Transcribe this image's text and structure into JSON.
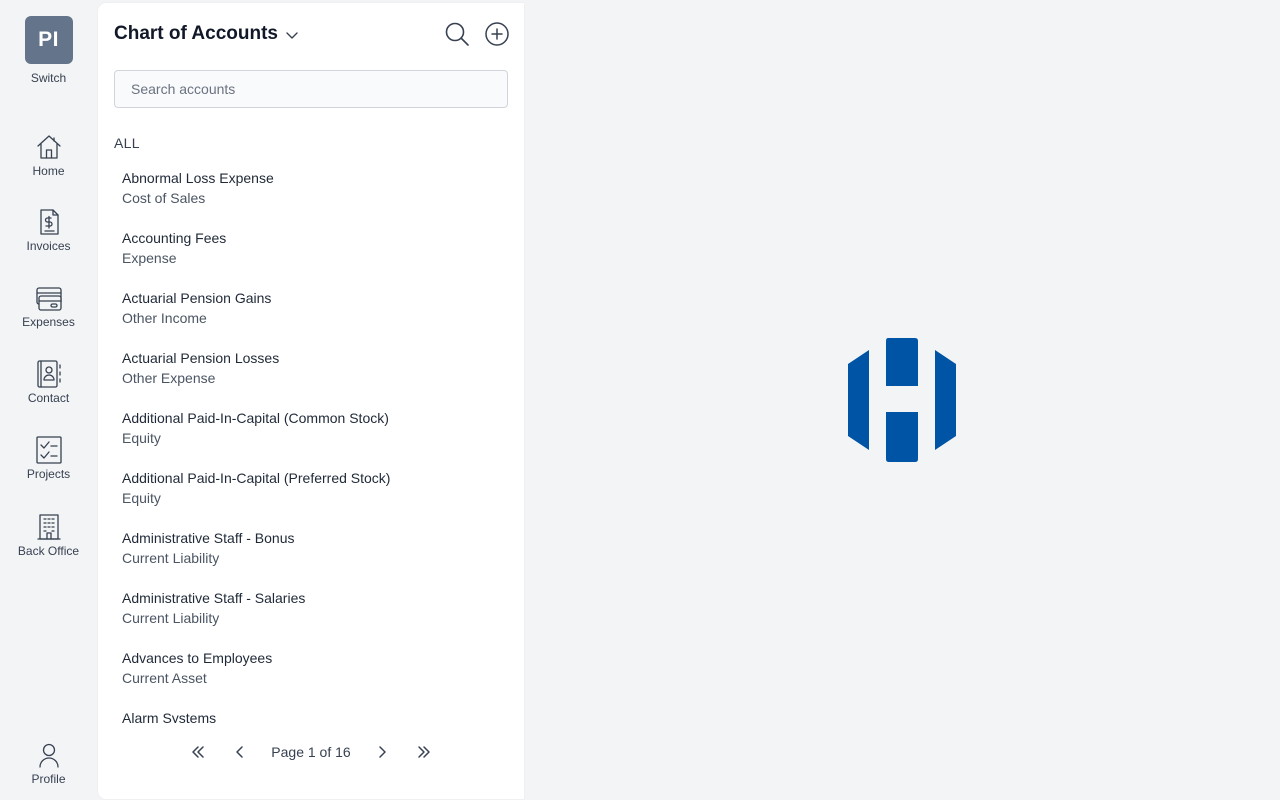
{
  "switch": {
    "badge": "PI",
    "label": "Switch"
  },
  "nav": {
    "home": "Home",
    "invoices": "Invoices",
    "expenses": "Expenses",
    "contact": "Contact",
    "projects": "Projects",
    "back_office": "Back Office",
    "profile": "Profile"
  },
  "panel": {
    "title": "Chart of Accounts",
    "search_placeholder": "Search accounts",
    "section_label": "ALL"
  },
  "accounts": [
    {
      "name": "Abnormal Loss Expense",
      "type": "Cost of Sales"
    },
    {
      "name": "Accounting Fees",
      "type": "Expense"
    },
    {
      "name": "Actuarial Pension Gains",
      "type": "Other Income"
    },
    {
      "name": "Actuarial Pension Losses",
      "type": "Other Expense"
    },
    {
      "name": "Additional Paid-In-Capital (Common Stock)",
      "type": "Equity"
    },
    {
      "name": "Additional Paid-In-Capital (Preferred Stock)",
      "type": "Equity"
    },
    {
      "name": "Administrative Staff - Bonus",
      "type": "Current Liability"
    },
    {
      "name": "Administrative Staff - Salaries",
      "type": "Current Liability"
    },
    {
      "name": "Advances to Employees",
      "type": "Current Asset"
    },
    {
      "name": "Alarm Systems",
      "type": ""
    }
  ],
  "pagination": {
    "text": "Page 1 of 16"
  },
  "colors": {
    "switch_badge": "#64748b",
    "logo_blue": "#0054a6",
    "background": "#f3f4f6"
  },
  "icons": {
    "home": "home-icon",
    "invoices": "invoice-dollar-icon",
    "expenses": "credit-card-icon",
    "contact": "contact-book-icon",
    "projects": "checklist-icon",
    "back_office": "building-icon",
    "profile": "user-icon",
    "search": "search-icon",
    "add": "plus-circle-icon",
    "title_chevron": "chevron-down-icon",
    "first_page": "chevrons-left-icon",
    "prev_page": "chevron-left-icon",
    "next_page": "chevron-right-icon",
    "last_page": "chevrons-right-icon"
  }
}
